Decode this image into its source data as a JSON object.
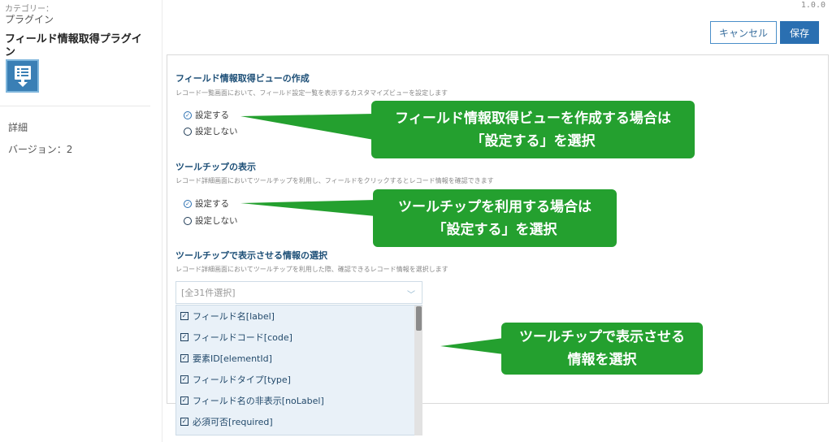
{
  "sidebar": {
    "category_label": "カテゴリー：",
    "category_value": "プラグイン",
    "plugin_name": "フィールド情報取得プラグイン",
    "details_label": "詳細",
    "version_label": "バージョン：2"
  },
  "header": {
    "version": "1.0.0",
    "cancel_label": "キャンセル",
    "save_label": "保存"
  },
  "sections": [
    {
      "title": "フィールド情報取得ビューの作成",
      "description": "レコード一覧画面において、フィールド設定一覧を表示するカスタマイズビューを設定します",
      "options": [
        "設定する",
        "設定しない"
      ],
      "selected": "設定する"
    },
    {
      "title": "ツールチップの表示",
      "description": "レコード詳細画面においてツールチップを利用し、フィールドをクリックするとレコード情報を確認できます",
      "options": [
        "設定する",
        "設定しない"
      ],
      "selected": "設定する"
    },
    {
      "title": "ツールチップで表示させる情報の選択",
      "description": "レコード詳細画面においてツールチップを利用した際、確認できるレコード情報を選択します"
    }
  ],
  "select": {
    "value": "[全31件選択]",
    "items": [
      "フィールド名[label]",
      "フィールドコード[code]",
      "要素ID[elementId]",
      "フィールドタイプ[type]",
      "フィールド名の非表示[noLabel]",
      "必須可否[required]"
    ]
  },
  "callouts": [
    {
      "line1": "フィールド情報取得ビューを作成する場合は",
      "line2": "「設定する」を選択"
    },
    {
      "line1": "ツールチップを利用する場合は",
      "line2": "「設定する」を選択"
    },
    {
      "line1": "ツールチップで表示させる",
      "line2": "情報を選択"
    }
  ],
  "colors": {
    "accent": "#2a6fb1",
    "callout": "#24a02f",
    "section_title": "#1d4f77"
  }
}
